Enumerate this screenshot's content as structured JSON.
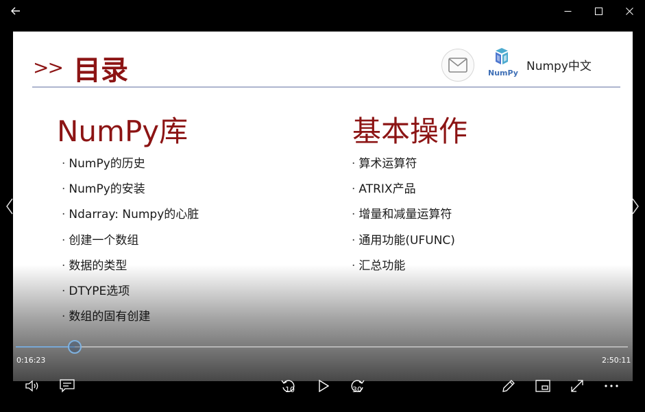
{
  "window": {
    "back_icon": "arrow-left-icon",
    "minimize_icon": "minimize-icon",
    "maximize_icon": "maximize-icon",
    "close_icon": "close-icon"
  },
  "slide": {
    "header_arrows": ">>",
    "header_title": "目录",
    "brand_name": "Numpy中文",
    "logo_text": "NumPy",
    "mail_icon": "mail-icon",
    "left_column": {
      "title": "NumPy库",
      "items": [
        "NumPy的历史",
        "NumPy的安装",
        "Ndarray: Numpy的心脏",
        "创建一个数组",
        "数据的类型",
        "DTYPE选项",
        "数组的固有创建"
      ]
    },
    "right_column": {
      "title": "基本操作",
      "items": [
        "算术运算符",
        "ATRIX产品",
        "增量和减量运算符",
        "通用功能(UFUNC)",
        "汇总功能"
      ]
    }
  },
  "player": {
    "current_time": "0:16:23",
    "total_time": "2:50:11",
    "progress_fraction": 0.0962,
    "skip_back_seconds": "10",
    "skip_forward_seconds": "30",
    "accent_color": "#78a8d6",
    "controls": {
      "volume_icon": "volume-icon",
      "subtitles_icon": "subtitles-icon",
      "play_icon": "play-icon",
      "edit_icon": "pen-icon",
      "mini_view_icon": "mini-view-icon",
      "fullscreen_icon": "fullscreen-icon",
      "more_icon": "more-icon"
    }
  }
}
